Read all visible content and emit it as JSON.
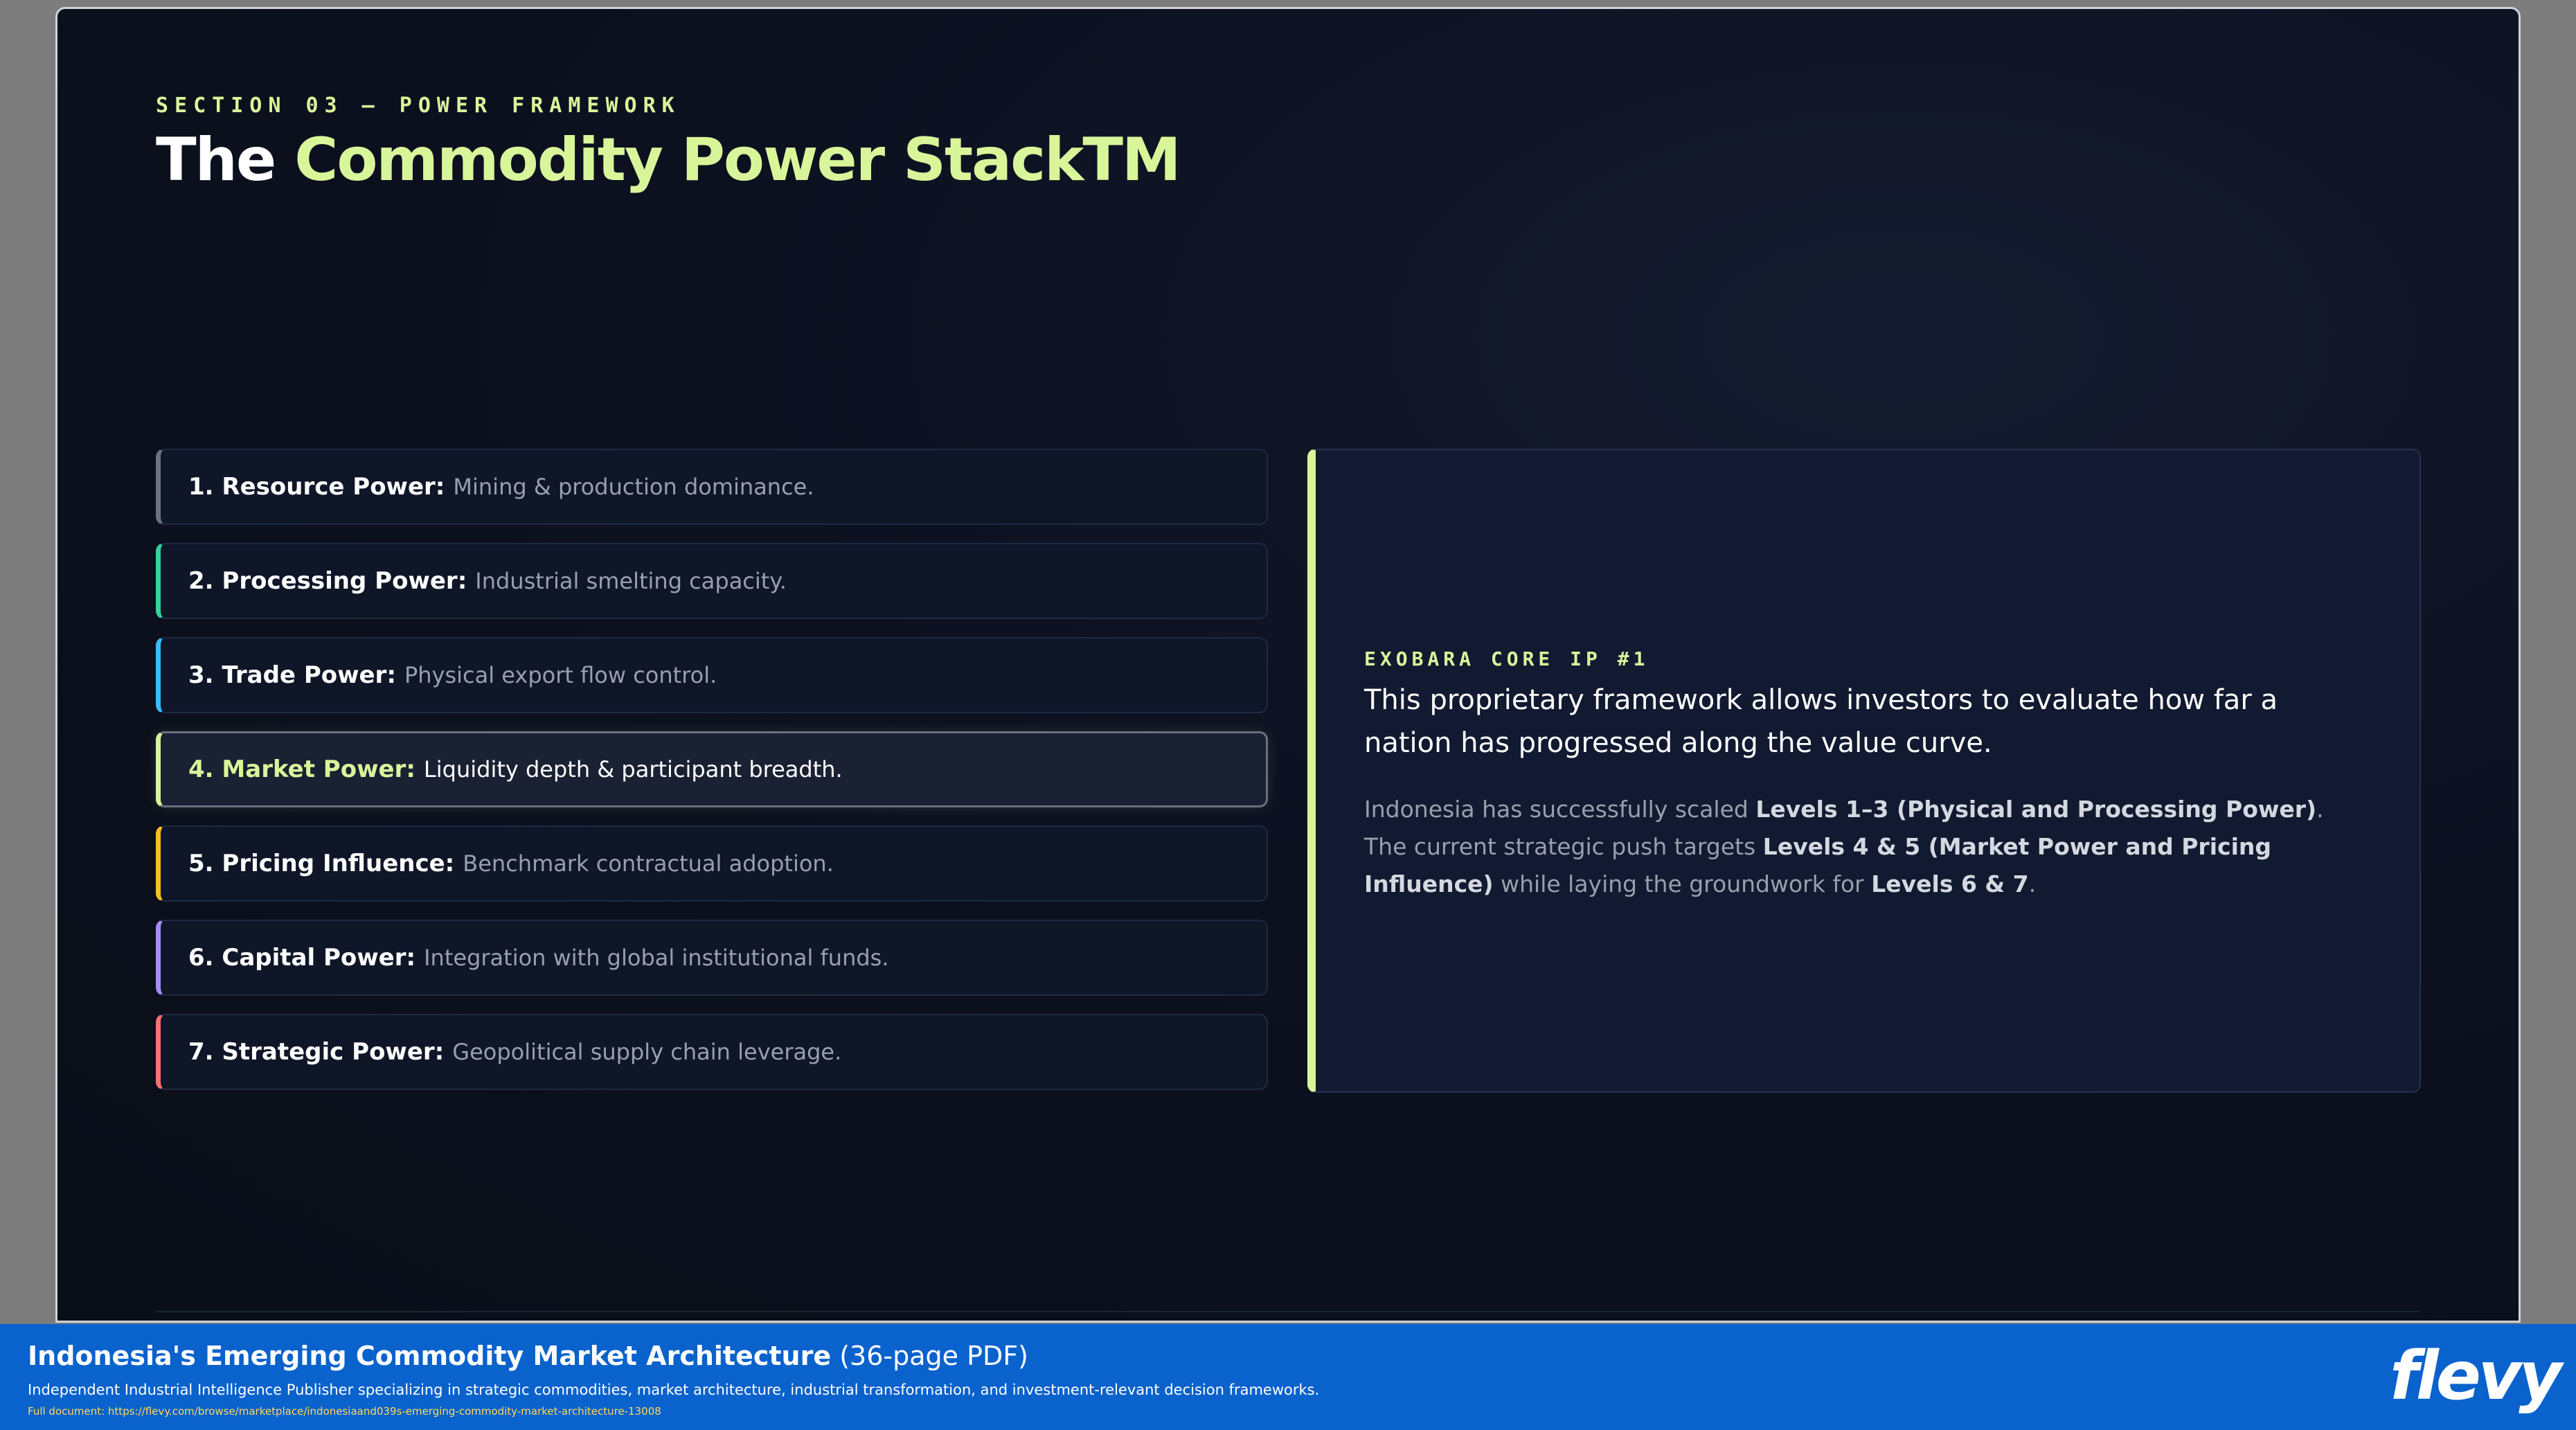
{
  "slide": {
    "eyebrow": "SECTION 03 — POWER FRAMEWORK",
    "title_prefix": "The",
    "title_accent": "Commodity Power StackTM"
  },
  "levels": [
    {
      "name": "1. Resource Power:",
      "desc": "Mining & production dominance.",
      "color": "#6b7280"
    },
    {
      "name": "2. Processing Power:",
      "desc": "Industrial smelting capacity.",
      "color": "#34d399"
    },
    {
      "name": "3. Trade Power:",
      "desc": "Physical export flow control.",
      "color": "#38bdf8"
    },
    {
      "name": "4. Market Power:",
      "desc": "Liquidity depth & participant breadth.",
      "color": "#d9f59a",
      "active": true
    },
    {
      "name": "5. Pricing Influence:",
      "desc": "Benchmark contractual adoption.",
      "color": "#fbbf24"
    },
    {
      "name": "6. Capital Power:",
      "desc": "Integration with global institutional funds.",
      "color": "#a78bfa"
    },
    {
      "name": "7. Strategic Power:",
      "desc": "Geopolitical supply chain leverage.",
      "color": "#f87171"
    }
  ],
  "card": {
    "tag": "EXOBARA CORE IP #1",
    "lead": "This proprietary framework allows investors to evaluate how far a nation has progressed along the value curve.",
    "body_1": "Indonesia has successfully scaled ",
    "body_b1": "Levels 1–3 (Physical and Processing Power)",
    "body_2": ". The current strategic push targets ",
    "body_b2": "Levels 4 & 5 (Market Power and Pricing Influence)",
    "body_3": " while laying the groundwork for ",
    "body_b3": "Levels 6 & 7",
    "body_4": "."
  },
  "banner": {
    "doc_title": "Indonesia's Emerging Commodity Market Architecture",
    "doc_pages": " (36-page PDF)",
    "tagline": "Independent Industrial Intelligence Publisher specializing in strategic commodities, market architecture, industrial transformation, and investment-relevant decision frameworks.",
    "url": "Full document: https://flevy.com/browse/marketplace/indonesiaand039s-emerging-commodity-market-architecture-13008",
    "logo": "flevy"
  }
}
